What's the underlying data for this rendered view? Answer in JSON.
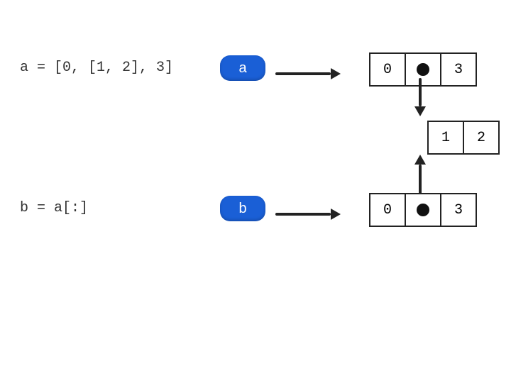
{
  "code": {
    "line_a": "a = [0, [1, 2], 3]",
    "line_b": "b = a[:]"
  },
  "vars": {
    "a_label": "a",
    "b_label": "b"
  },
  "arrays": {
    "a_cells": [
      "0",
      "",
      "3"
    ],
    "b_cells": [
      "0",
      "",
      "3"
    ],
    "inner_cells": [
      "1",
      "2"
    ]
  },
  "colors": {
    "node_fill": "#1a5fd6",
    "stroke": "#222222"
  }
}
